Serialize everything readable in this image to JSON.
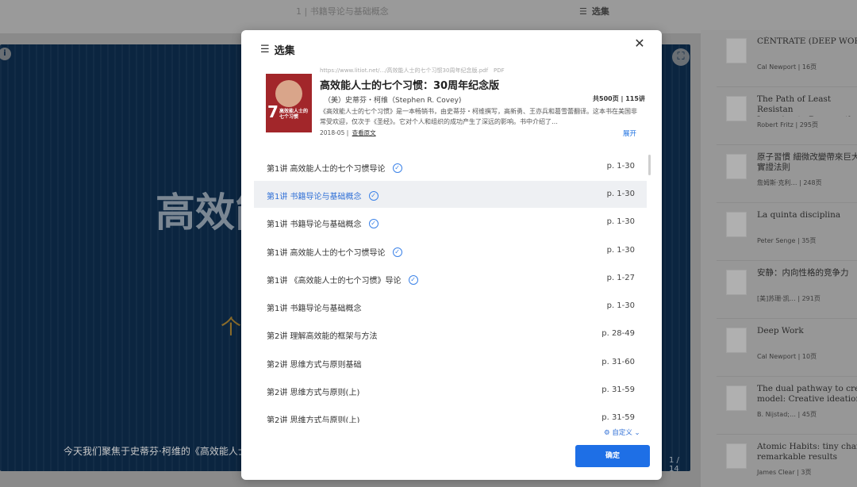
{
  "background": {
    "header_title": "1 | 书籍导论与基础概念",
    "header_select_label": "选集",
    "slide_title": "高效能",
    "slide_gold_text": "个",
    "slide_caption": "今天我们聚焦于史蒂芬·柯维的《高效能人士",
    "slide_page": "1 / 14"
  },
  "rightlist": [
    {
      "title": "CÉNTRATE (DEEP WORK",
      "meta": "Cal Newport | 16页"
    },
    {
      "title": "The Path of Least Resistan\nLearning to Become the",
      "meta": "Robert Fritz | 295页"
    },
    {
      "title": "原子習慣 細微改變帶來巨大\n實證法則",
      "meta": "詹姆斯·克利… | 248页"
    },
    {
      "title": "La quinta disciplina",
      "meta": "Peter Senge | 35页"
    },
    {
      "title": "安静：内向性格的竞争力",
      "meta": "[美]苏珊·凯… | 291页"
    },
    {
      "title": "Deep Work",
      "meta": "Cal Newport | 10页"
    },
    {
      "title": "The dual pathway to crea\nmodel: Creative ideation a",
      "meta": "B. Nijstad;… | 45页"
    },
    {
      "title": "Atomic Habits: tiny chang\nremarkable results",
      "meta": "James Clear | 3页"
    }
  ],
  "modal": {
    "title": "选集",
    "book": {
      "url": "https://www.litiot.net/.../高效能人士的七个习惯30周年纪念版.pdf",
      "type": "PDF",
      "title": "高效能人士的七个习惯：30周年纪念版",
      "author": "（美）史蒂芬・柯维（Stephen R. Covey)",
      "stats": "共500页 | 115讲",
      "description": "《高效能人士的七个习惯》是一本畅销书，由史蒂芬・柯维撰写，高新勇、王亦兵和葛雪蕾翻译。这本书在美国非常受欢迎，仅次于《圣经》。它对个人和组织的成功产生了深远的影响。书中介绍了…",
      "date": "2018-05 |",
      "view_original": "查看原文",
      "expand": "展开",
      "cover_text": "高效能人士的\n七个习惯"
    },
    "chapters": [
      {
        "label": "第1讲 高效能人士的七个习惯导论",
        "pages": "p. 1-30",
        "checked": true
      },
      {
        "label": "第1讲 书籍导论与基础概念",
        "pages": "p. 1-30",
        "checked": true,
        "active": true
      },
      {
        "label": "第1讲 书籍导论与基础概念",
        "pages": "p. 1-30",
        "checked": true
      },
      {
        "label": "第1讲 高效能人士的七个习惯导论",
        "pages": "p. 1-30",
        "checked": true
      },
      {
        "label": "第1讲 《高效能人士的七个习惯》导论",
        "pages": "p. 1-27",
        "checked": true
      },
      {
        "label": "第1讲 书籍导论与基础概念",
        "pages": "p. 1-30",
        "checked": false
      },
      {
        "label": "第2讲 理解高效能的框架与方法",
        "pages": "p. 28-49",
        "checked": false
      },
      {
        "label": "第2讲 思维方式与原则基础",
        "pages": "p. 31-60",
        "checked": false
      },
      {
        "label": "第2讲 思维方式与原则(上)",
        "pages": "p. 31-59",
        "checked": false
      },
      {
        "label": "第2讲 思维方式与原则(上)",
        "pages": "p. 31-59",
        "checked": false
      }
    ],
    "custom_label": "自定义",
    "confirm_label": "确定"
  }
}
